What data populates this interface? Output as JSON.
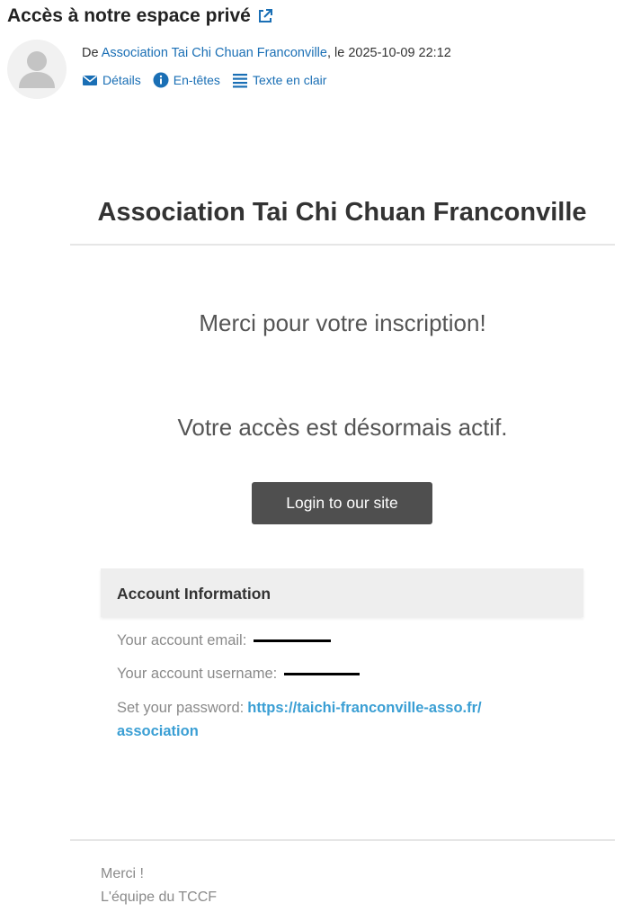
{
  "header": {
    "subject": "Accès à notre espace privé",
    "from_prefix": "De ",
    "sender": "Association Tai Chi Chuan Franconville",
    "date_text": ", le 2025-10-09 22:12",
    "actions": {
      "details": "Détails",
      "headers": "En-têtes",
      "plaintext": "Texte en clair"
    }
  },
  "email": {
    "org_title": "Association Tai Chi Chuan Franconville",
    "thanks": "Merci pour votre inscription!",
    "active": "Votre accès est désormais actif.",
    "login_button": "Login to our site",
    "account_heading": "Account Information",
    "email_label": "Your account email:",
    "username_label": "Your account username:",
    "password_label": "Set your password:",
    "password_link_1": "https://taichi-franconville-asso.fr/",
    "password_link_2": "association",
    "sign_off": "Merci !",
    "signature": "L'équipe du TCCF"
  },
  "colors": {
    "link": "#1a6fb5",
    "button": "#4f4f4f",
    "password_link": "#3b9fd4"
  },
  "icons": [
    "external-link-icon",
    "avatar-icon",
    "envelope-icon",
    "info-icon",
    "list-icon"
  ]
}
